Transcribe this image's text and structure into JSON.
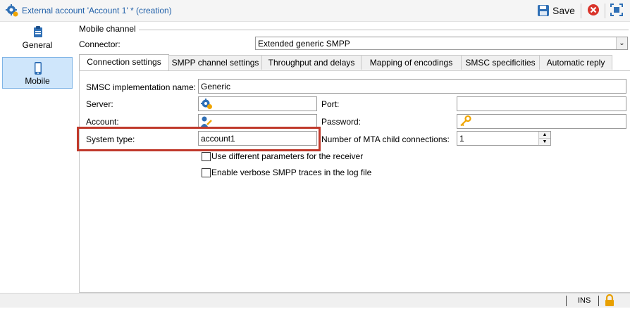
{
  "window": {
    "title": "External account 'Account 1' * (creation)",
    "save_label": "Save"
  },
  "sidebar": {
    "items": [
      {
        "label": "General",
        "icon": "clipboard-icon",
        "active": false
      },
      {
        "label": "Mobile",
        "icon": "mobile-phone-icon",
        "active": true
      }
    ]
  },
  "main": {
    "section_title": "Mobile channel",
    "connector_label": "Connector:",
    "connector_value": "Extended generic SMPP",
    "tabs": [
      {
        "label": "Connection settings"
      },
      {
        "label": "SMPP channel settings"
      },
      {
        "label": "Throughput and delays"
      },
      {
        "label": "Mapping of encodings"
      },
      {
        "label": "SMSC specificities"
      },
      {
        "label": "Automatic reply"
      }
    ],
    "form": {
      "smsc_label": "SMSC implementation name:",
      "smsc_value": "Generic",
      "server_label": "Server:",
      "server_value": "",
      "port_label": "Port:",
      "port_value": "",
      "account_label": "Account:",
      "account_value": "",
      "password_label": "Password:",
      "password_value": "",
      "system_type_label": "System type:",
      "system_type_value": "account1",
      "mta_label": "Number of MTA child connections:",
      "mta_value": "1",
      "chk_receiver_label": "Use different parameters for the receiver",
      "chk_verbose_label": "Enable verbose SMPP traces in the log file"
    }
  },
  "statusbar": {
    "mode": "INS"
  },
  "colors": {
    "title_text": "#1f5fa8",
    "active_item_bg": "#cfe6fb",
    "highlight_border": "#c0392b",
    "lock_icon": "#e8a000"
  }
}
